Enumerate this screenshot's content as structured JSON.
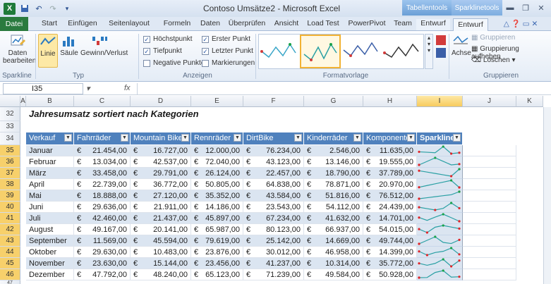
{
  "titlebar": {
    "title": "Contoso Umsätze2 - Microsoft Excel",
    "context_tabs": [
      "Tabellentools",
      "Sparklinetools"
    ],
    "logo": "X",
    "qat": [
      "save-icon",
      "undo-icon",
      "redo-icon",
      "customize-icon"
    ]
  },
  "tabs": [
    "Datei",
    "Start",
    "Einfügen",
    "Seitenlayout",
    "Formeln",
    "Daten",
    "Überprüfen",
    "Ansicht",
    "Load Test",
    "PowerPivot",
    "Team",
    "Entwurf",
    "Entwurf"
  ],
  "ribbon": {
    "sparkline_group": {
      "label": "Sparkline",
      "button": "Daten bearbeiten"
    },
    "typ_group": {
      "label": "Typ",
      "buttons": [
        "Linie",
        "Säule",
        "Gewinn/Verlust"
      ]
    },
    "anzeigen_group": {
      "label": "Anzeigen",
      "checks": [
        {
          "label": "Höchstpunkt",
          "checked": true
        },
        {
          "label": "Tiefpunkt",
          "checked": true
        },
        {
          "label": "Negative Punkte",
          "checked": false
        },
        {
          "label": "Erster Punkt",
          "checked": true
        },
        {
          "label": "Letzter Punkt",
          "checked": true
        },
        {
          "label": "Markierungen",
          "checked": false
        }
      ]
    },
    "formatvorlage_group": {
      "label": "Formatvorlage"
    },
    "gruppieren_group": {
      "label": "Gruppieren",
      "achse": "Achse",
      "items": [
        "Gruppieren",
        "Gruppierung aufheben",
        "Löschen"
      ]
    }
  },
  "formula_bar": {
    "name_box": "I35",
    "fx": "fx",
    "value": ""
  },
  "columns": [
    "A",
    "B",
    "C",
    "D",
    "E",
    "F",
    "G",
    "H",
    "I",
    "J",
    "K"
  ],
  "rows": {
    "r32": "32",
    "r33": "33",
    "r34": "34",
    "r47": "47",
    "title": "Jahresumsatz sortiert nach Kategorien"
  },
  "table": {
    "headers": [
      "Verkauf",
      "Fahrräder",
      "Mountain Bike",
      "Rennräder",
      "DirtBike",
      "Kinderräder",
      "Komponenten",
      "Sparklines"
    ],
    "currency": "€",
    "data": [
      {
        "row": "35",
        "month": "Januar",
        "v": [
          "21.454,00",
          "16.727,00",
          "12.000,00",
          "76.234,00",
          "2.546,00",
          "11.635,00"
        ]
      },
      {
        "row": "36",
        "month": "Februar",
        "v": [
          "13.034,00",
          "42.537,00",
          "72.040,00",
          "43.123,00",
          "13.146,00",
          "19.555,00"
        ]
      },
      {
        "row": "37",
        "month": "März",
        "v": [
          "33.458,00",
          "29.791,00",
          "26.124,00",
          "22.457,00",
          "18.790,00",
          "37.789,00"
        ]
      },
      {
        "row": "38",
        "month": "April",
        "v": [
          "22.739,00",
          "36.772,00",
          "50.805,00",
          "64.838,00",
          "78.871,00",
          "20.970,00"
        ]
      },
      {
        "row": "39",
        "month": "Mai",
        "v": [
          "18.888,00",
          "27.120,00",
          "35.352,00",
          "43.584,00",
          "51.816,00",
          "76.512,00"
        ]
      },
      {
        "row": "40",
        "month": "Juni",
        "v": [
          "29.636,00",
          "21.911,00",
          "14.186,00",
          "23.543,00",
          "54.112,00",
          "24.439,00"
        ]
      },
      {
        "row": "41",
        "month": "Juli",
        "v": [
          "42.460,00",
          "21.437,00",
          "45.897,00",
          "67.234,00",
          "41.632,00",
          "14.701,00"
        ]
      },
      {
        "row": "42",
        "month": "August",
        "v": [
          "49.167,00",
          "20.141,00",
          "65.987,00",
          "80.123,00",
          "66.937,00",
          "54.015,00"
        ]
      },
      {
        "row": "43",
        "month": "September",
        "v": [
          "11.569,00",
          "45.594,00",
          "79.619,00",
          "25.142,00",
          "14.669,00",
          "49.744,00"
        ]
      },
      {
        "row": "44",
        "month": "Oktober",
        "v": [
          "29.630,00",
          "10.483,00",
          "23.876,00",
          "30.012,00",
          "46.958,00",
          "14.399,00"
        ]
      },
      {
        "row": "45",
        "month": "November",
        "v": [
          "23.630,00",
          "15.144,00",
          "23.456,00",
          "41.237,00",
          "10.314,00",
          "35.772,00"
        ]
      },
      {
        "row": "46",
        "month": "Dezember",
        "v": [
          "47.792,00",
          "48.240,00",
          "65.123,00",
          "71.239,00",
          "49.584,00",
          "50.928,00"
        ]
      }
    ]
  },
  "colors": {
    "accent": "#4f81bd",
    "band": "#dbe5f1",
    "header_text": "#ffffff",
    "spark_line": "#2aa0a4",
    "spark_high": "#19a24a",
    "spark_low": "#e0262a"
  }
}
